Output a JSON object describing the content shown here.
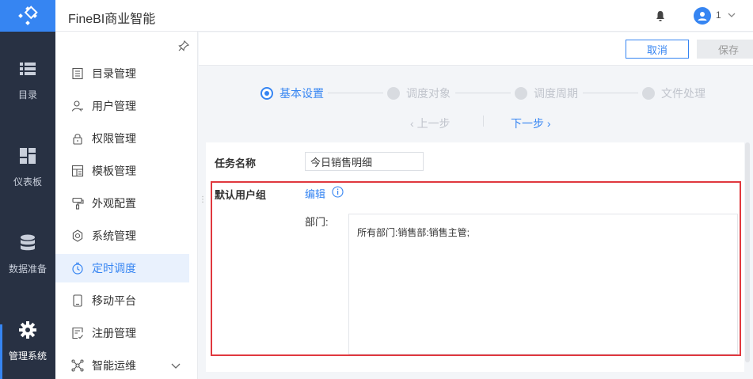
{
  "app": {
    "title": "FineBI商业智能"
  },
  "header": {
    "user_name": "1"
  },
  "leftnav": {
    "items": [
      {
        "label": "目录",
        "icon": "list-icon"
      },
      {
        "label": "仪表板",
        "icon": "dashboard-icon"
      },
      {
        "label": "数据准备",
        "icon": "database-icon"
      },
      {
        "label": "管理系统",
        "icon": "gear-icon",
        "active": true
      }
    ]
  },
  "submenu": {
    "items": [
      {
        "label": "目录管理",
        "icon": "catalog-icon"
      },
      {
        "label": "用户管理",
        "icon": "user-icon"
      },
      {
        "label": "权限管理",
        "icon": "lock-icon"
      },
      {
        "label": "模板管理",
        "icon": "template-icon"
      },
      {
        "label": "外观配置",
        "icon": "brush-icon"
      },
      {
        "label": "系统管理",
        "icon": "settings-icon"
      },
      {
        "label": "定时调度",
        "icon": "clock-icon",
        "active": true
      },
      {
        "label": "移动平台",
        "icon": "mobile-icon"
      },
      {
        "label": "注册管理",
        "icon": "register-icon"
      },
      {
        "label": "智能运维",
        "icon": "network-icon"
      }
    ]
  },
  "toolbar": {
    "cancel_label": "取消",
    "save_label": "保存"
  },
  "steps": {
    "items": [
      {
        "label": "基本设置",
        "active": true
      },
      {
        "label": "调度对象"
      },
      {
        "label": "调度周期"
      },
      {
        "label": "文件处理"
      }
    ],
    "prev_label": "上一步",
    "next_label": "下一步"
  },
  "form": {
    "task_name_label": "任务名称",
    "task_name_value": "今日销售明细",
    "default_group_label": "默认用户组",
    "edit_label": "编辑",
    "dept_label": "部门:",
    "dept_value": "所有部门:销售部:销售主管;"
  },
  "colors": {
    "accent": "#3685f2",
    "sidebar": "#283143",
    "highlight": "#e0383e"
  }
}
